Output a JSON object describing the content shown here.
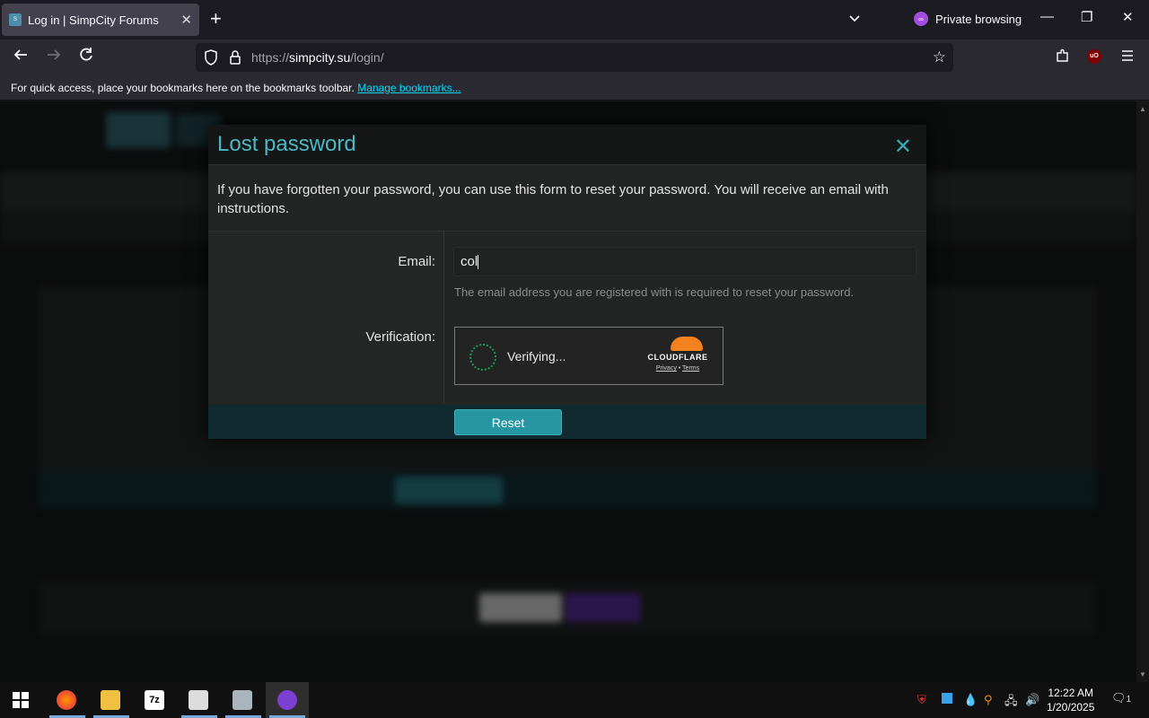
{
  "browser": {
    "tab_title": "Log in | SimpCity Forums",
    "favicon_text": "SIMP CITY",
    "private_label": "Private browsing",
    "url_prefix": "https://",
    "url_domain": "simpcity.su",
    "url_path": "/login/",
    "bookmarks_text": "For quick access, place your bookmarks here on the bookmarks toolbar.",
    "bookmarks_link": "Manage bookmarks...",
    "ublock_label": "uO"
  },
  "modal": {
    "title": "Lost password",
    "description": "If you have forgotten your password, you can use this form to reset your password. You will receive an email with instructions.",
    "email_label": "Email:",
    "email_value": "col",
    "email_hint": "The email address you are registered with is required to reset your password.",
    "verification_label": "Verification:",
    "turnstile_status": "Verifying...",
    "cloudflare_brand": "CLOUDFLARE",
    "cloudflare_privacy": "Privacy",
    "cloudflare_sep": " • ",
    "cloudflare_terms": "Terms",
    "reset_button": "Reset"
  },
  "taskbar": {
    "time": "12:22 AM",
    "date": "1/20/2025",
    "notification_count": "1"
  },
  "colors": {
    "accent": "#2697a2",
    "title": "#4bb8c4",
    "cloudflare_orange": "#f48120"
  }
}
